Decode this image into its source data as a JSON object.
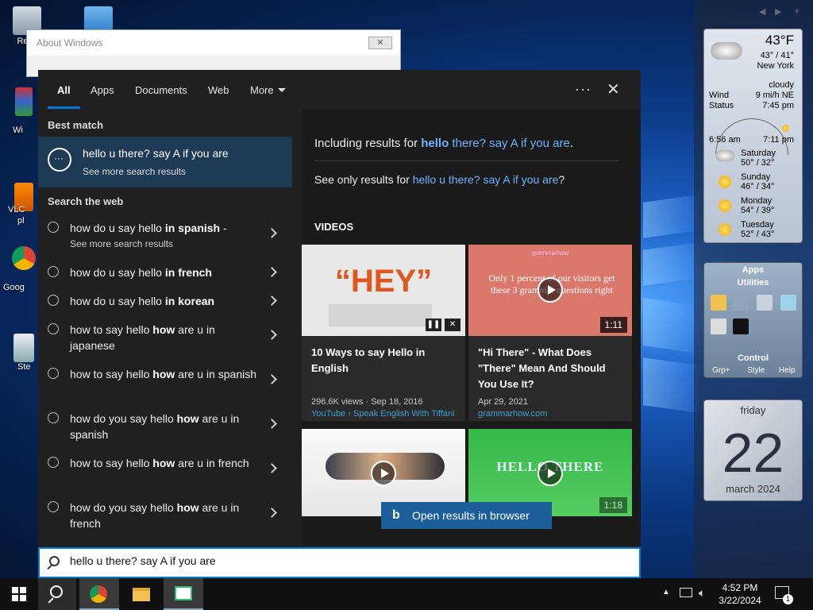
{
  "desktop": {
    "icons": [
      {
        "label": "Recy"
      },
      {
        "label": "Wi"
      },
      {
        "label": "VLC"
      },
      {
        "label": "pl"
      },
      {
        "label": "Goog"
      },
      {
        "label": "Ste"
      }
    ]
  },
  "about_window": {
    "title": "About Windows",
    "close": "✕"
  },
  "search": {
    "tabs": [
      "All",
      "Apps",
      "Documents",
      "Web",
      "More"
    ],
    "more_dots": "···",
    "close": "✕",
    "best_match_title": "Best match",
    "best_match": {
      "title": "hello u there? say A if you are",
      "subtitle": "See more search results"
    },
    "search_web_title": "Search the web",
    "suggestions": [
      {
        "plain": "how do u say hello ",
        "bold": "in spanish",
        "tail": " -",
        "sub": "See more search results"
      },
      {
        "plain": "how do u say hello ",
        "bold": "in french",
        "tail": "",
        "sub": ""
      },
      {
        "plain": "how do u say hello ",
        "bold": "in korean",
        "tail": "",
        "sub": ""
      },
      {
        "plain": "how to say hello ",
        "bold": "how",
        "tail": " are u in japanese",
        "sub": ""
      },
      {
        "plain": "how to say hello ",
        "bold": "how",
        "tail": " are u in spanish",
        "sub": ""
      },
      {
        "plain": "how do you say hello ",
        "bold": "how",
        "tail": " are u in spanish",
        "sub": ""
      },
      {
        "plain": "how to say hello ",
        "bold": "how",
        "tail": " are u in french",
        "sub": ""
      },
      {
        "plain": "how do you say hello ",
        "bold": "how",
        "tail": " are u in french",
        "sub": ""
      }
    ],
    "including_prefix": "Including results for ",
    "including_bold": "hello",
    "including_rest": " there? say A if you are",
    "including_end": ".",
    "only_prefix": "See only results for ",
    "only_link": "hello u there? say A if you are",
    "only_end": "?",
    "videos_title": "VIDEOS",
    "videos": [
      {
        "title": "10 Ways to say Hello in English",
        "meta": "296.6K views · Sep 18, 2016",
        "source": "YouTube › Speak English With Tiffani",
        "duration": "",
        "thumb_text": "“HEY”"
      },
      {
        "title": "\"Hi There\" - What Does \"There\" Mean And Should You Use It?",
        "meta": "Apr 29, 2021",
        "source": "grammarhow.com",
        "duration": "1:11",
        "thumb_text": "Only 1 percent of our visitors get these 3 grammar questions right"
      },
      {
        "title": "",
        "meta": "",
        "source": "",
        "duration": "",
        "thumb_text": ""
      },
      {
        "title": "",
        "meta": "",
        "source": "",
        "duration": "1:18",
        "thumb_text": "HELLO THERE"
      }
    ],
    "open_browser": "Open results in browser",
    "bing_glyph": "b",
    "query": "hello u there? say A if you are"
  },
  "weather": {
    "temp": "43°F",
    "range": "43° / 41°",
    "city": "New York",
    "cond": "cloudy",
    "wind_label": "Wind",
    "wind": "9 mi/h NE",
    "status_label": "Status",
    "status": "7:45 pm",
    "sunrise": "6:56 am",
    "sunset": "7:11 pm",
    "forecast": [
      {
        "day": "Saturday",
        "temps": "50° / 32°"
      },
      {
        "day": "Sunday",
        "temps": "46° / 34°"
      },
      {
        "day": "Monday",
        "temps": "54° / 39°"
      },
      {
        "day": "Tuesday",
        "temps": "52° / 43°"
      }
    ]
  },
  "apps_gadget": {
    "title": "Apps",
    "sub": "Utilities",
    "control": "Control",
    "links": [
      "Grp+",
      "Style",
      "Help"
    ]
  },
  "calendar": {
    "day": "friday",
    "date": "22",
    "month": "march 2024"
  },
  "taskbar": {
    "time": "4:52 PM",
    "date": "3/22/2024",
    "notif": "1"
  },
  "colors": {
    "accent": "#0078d4",
    "link": "#6bb3ff",
    "panel": "#202020"
  }
}
